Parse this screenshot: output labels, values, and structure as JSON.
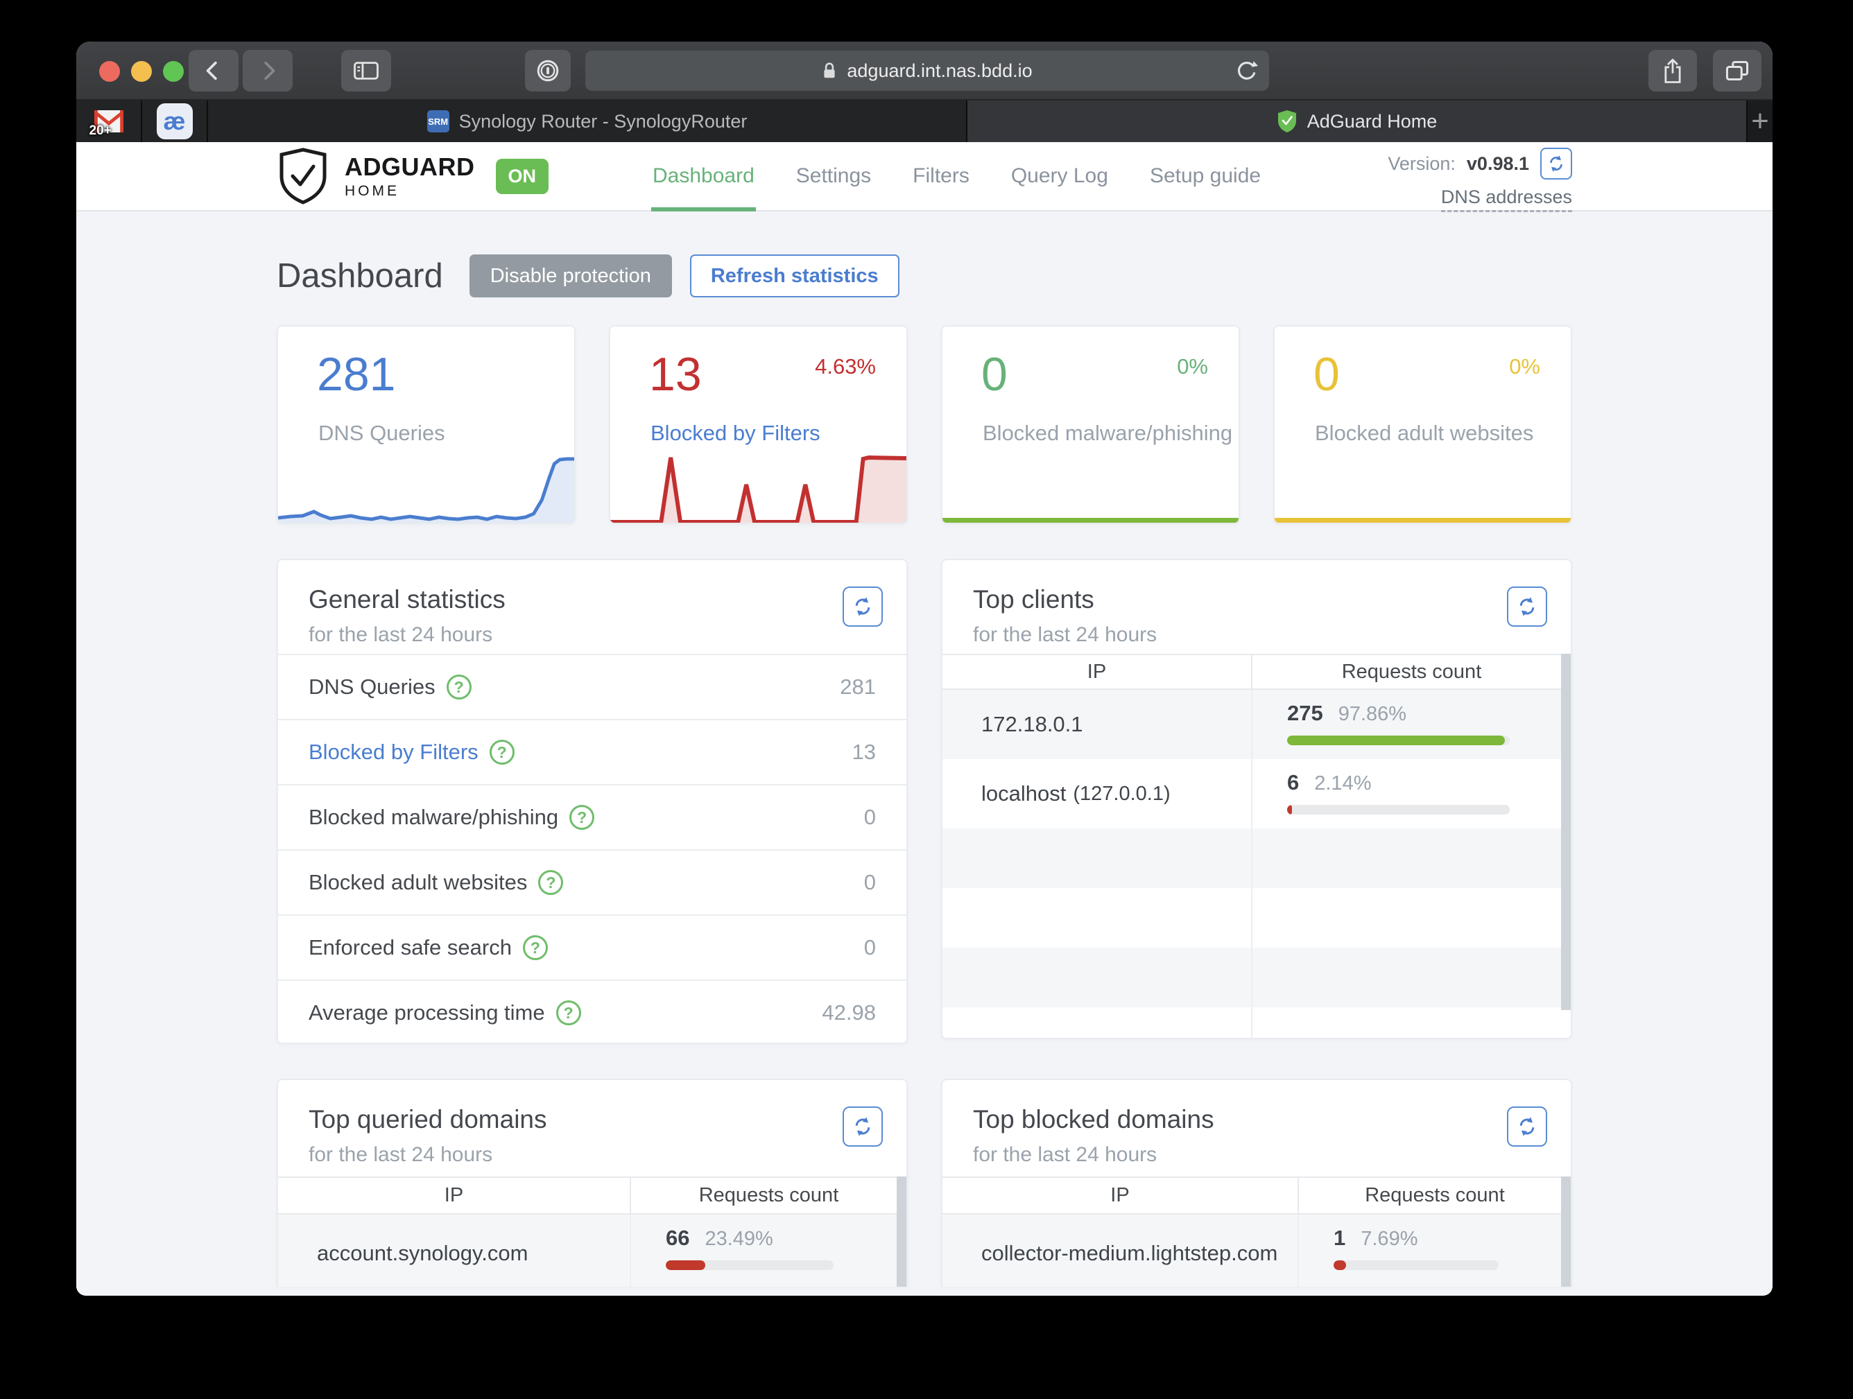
{
  "colors": {
    "blue": "#4a7dcf",
    "red": "#c23030",
    "green": "#67b279",
    "lime": "#7db83a",
    "bar_red": "#c0392b",
    "yellow": "#e8c237",
    "badge_green": "#6abd54"
  },
  "browser": {
    "url": "adguard.int.nas.bdd.io",
    "pinned_tabs": [
      {
        "name": "gmail",
        "badge": "20+"
      },
      {
        "name": "ae",
        "glyph": "æ"
      }
    ],
    "tabs": [
      {
        "title": "Synology Router - SynologyRouter",
        "favicon": "SRM",
        "active": false
      },
      {
        "title": "AdGuard Home",
        "active": true
      }
    ],
    "new_tab_label": "+"
  },
  "app_header": {
    "brand_top": "ADGUARD",
    "brand_bottom": "HOME",
    "status_badge": "ON",
    "nav": [
      {
        "label": "Dashboard",
        "active": true
      },
      {
        "label": "Settings",
        "active": false
      },
      {
        "label": "Filters",
        "active": false
      },
      {
        "label": "Query Log",
        "active": false
      },
      {
        "label": "Setup guide",
        "active": false
      }
    ],
    "version_label": "Version:",
    "version_value": "v0.98.1",
    "dns_addresses_link": "DNS addresses"
  },
  "page": {
    "title": "Dashboard",
    "disable_button": "Disable protection",
    "refresh_button": "Refresh statistics"
  },
  "stat_cards": [
    {
      "value": "281",
      "percent": "",
      "label": "DNS Queries",
      "color": "#4a7dcf",
      "spark_line": "0,90 18,88 36,87 52,81 62,86 76,91 92,89 106,87 120,90 136,92 150,89 164,92 178,90 192,88 206,90 220,92 234,89 248,91 262,92 276,90 290,89 304,92 318,88 332,90 346,91 360,89 372,84 384,64 394,34 402,12 410,6 420,5 431,5",
      "spark_fill": "0,90 18,88 36,87 52,81 62,86 76,91 92,89 106,87 120,90 136,92 150,89 164,92 178,90 192,88 206,90 220,92 234,89 248,91 262,92 276,90 290,89 304,92 318,88 332,90 346,91 360,89 372,84 384,64 394,34 402,12 410,6 420,5 431,5 431,100 0,100"
    },
    {
      "value": "13",
      "percent": "4.63%",
      "label": "Blocked by Filters",
      "color": "#c23030",
      "spark_line": "0,101 74,101 88,8 102,101 186,101 198,47 210,101 272,101 284,47 296,101 358,101 368,10 376,8 431,9",
      "spark_fill": "0,101 74,101 88,8 102,101 186,101 198,47 210,101 272,101 284,47 296,101 358,101 368,10 376,8 431,9 431,105 0,105"
    },
    {
      "value": "0",
      "percent": "0%",
      "label": "Blocked malware/phishing",
      "color": "#67b279"
    },
    {
      "value": "0",
      "percent": "0%",
      "label": "Blocked adult websites",
      "color": "#e8c237"
    }
  ],
  "general_stats": {
    "title": "General statistics",
    "subtitle": "for the last 24 hours",
    "rows": [
      {
        "label": "DNS Queries",
        "value": "281",
        "link": false
      },
      {
        "label": "Blocked by Filters",
        "value": "13",
        "link": true
      },
      {
        "label": "Blocked malware/phishing",
        "value": "0",
        "link": false
      },
      {
        "label": "Blocked adult websites",
        "value": "0",
        "link": false
      },
      {
        "label": "Enforced safe search",
        "value": "0",
        "link": false
      },
      {
        "label": "Average processing time",
        "value": "42.98",
        "link": false
      }
    ]
  },
  "top_clients": {
    "title": "Top clients",
    "subtitle": "for the last 24 hours",
    "col_ip": "IP",
    "col_count": "Requests count",
    "rows": [
      {
        "ip": "172.18.0.1",
        "ip_note": "",
        "count": "275",
        "percent": "97.86%",
        "bar_width": "97.86%",
        "bar_color": "#7db83a"
      },
      {
        "ip": "localhost",
        "ip_note": "(127.0.0.1)",
        "count": "6",
        "percent": "2.14%",
        "bar_width": "2.14%",
        "bar_color": "#c0392b"
      }
    ]
  },
  "top_queried": {
    "title": "Top queried domains",
    "subtitle": "for the last 24 hours",
    "col_ip": "IP",
    "col_count": "Requests count",
    "rows": [
      {
        "domain": "account.synology.com",
        "count": "66",
        "percent": "23.49%",
        "bar_width": "23.49%",
        "bar_color": "#c0392b"
      }
    ]
  },
  "top_blocked": {
    "title": "Top blocked domains",
    "subtitle": "for the last 24 hours",
    "col_ip": "IP",
    "col_count": "Requests count",
    "rows": [
      {
        "domain": "collector-medium.lightstep.com",
        "count": "1",
        "percent": "7.69%",
        "bar_width": "7.69%",
        "bar_color": "#c0392b"
      }
    ]
  }
}
